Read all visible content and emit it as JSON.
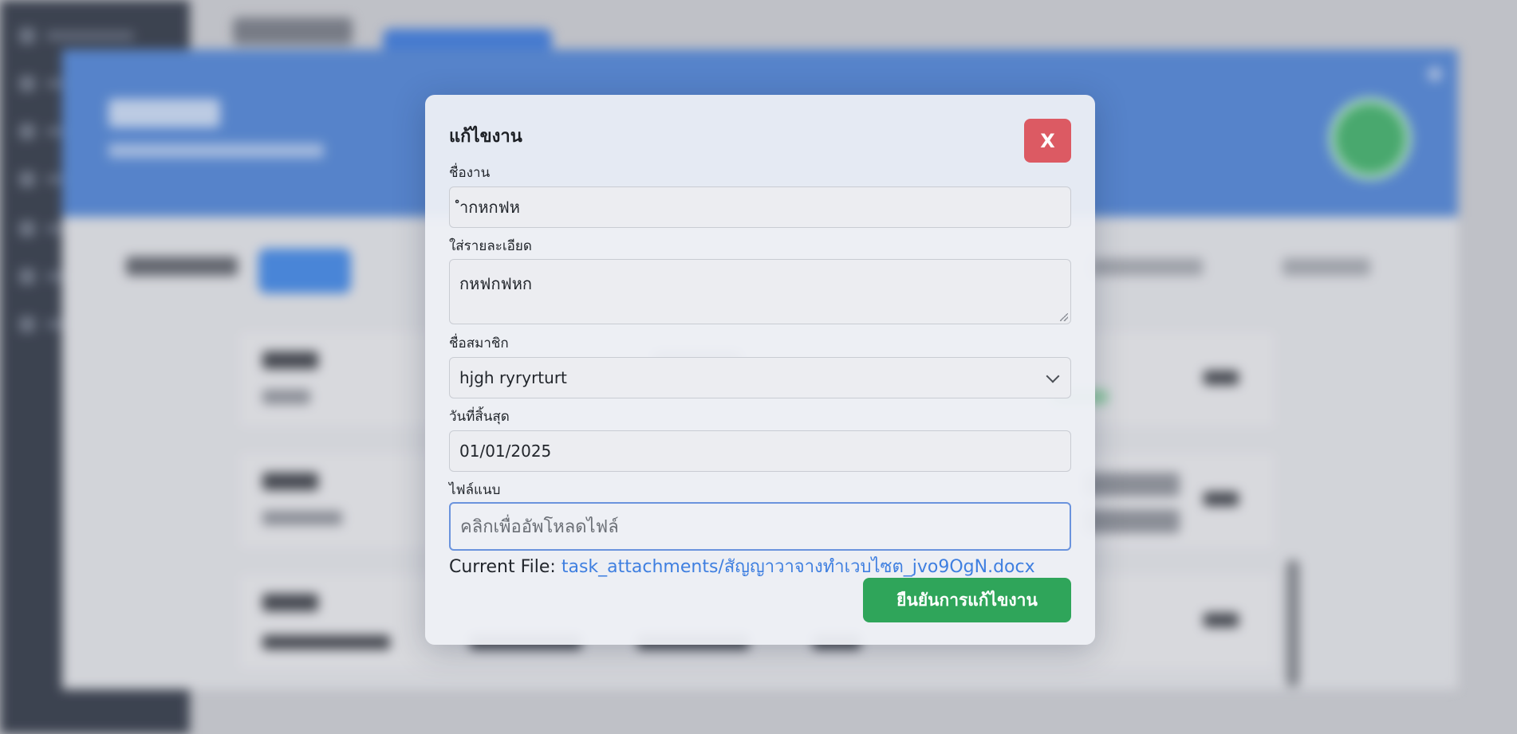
{
  "modal": {
    "title": "แก้ไขงาน",
    "close_label": "X",
    "fields": {
      "task_name": {
        "label": "ชื่องาน",
        "value": "ำกหกฟห"
      },
      "details": {
        "label": "ใส่รายละเอียด",
        "value": "กหฟกฟหก"
      },
      "member": {
        "label": "ชื่อสมาชิก",
        "selected": "hjgh ryryrturt"
      },
      "due_date": {
        "label": "วันที่สิ้นสุด",
        "value": "01/01/2025"
      },
      "attachment": {
        "label": "ไฟล์แนบ",
        "placeholder": "คลิกเพื่ออัพโหลดไฟล์"
      }
    },
    "current_file_label": "Current File:",
    "current_file_path": "task_attachments/สัญญาวาจางทำเวบไซต_jvo9OgN.docx",
    "confirm_label": "ยืนยันการแก้ไขงาน"
  },
  "colors": {
    "close_button": "#dc5a63",
    "confirm_button": "#2fa55a",
    "link": "#3f7fe0",
    "header_blue": "#4f86d9",
    "sidebar": "#2f3745"
  }
}
